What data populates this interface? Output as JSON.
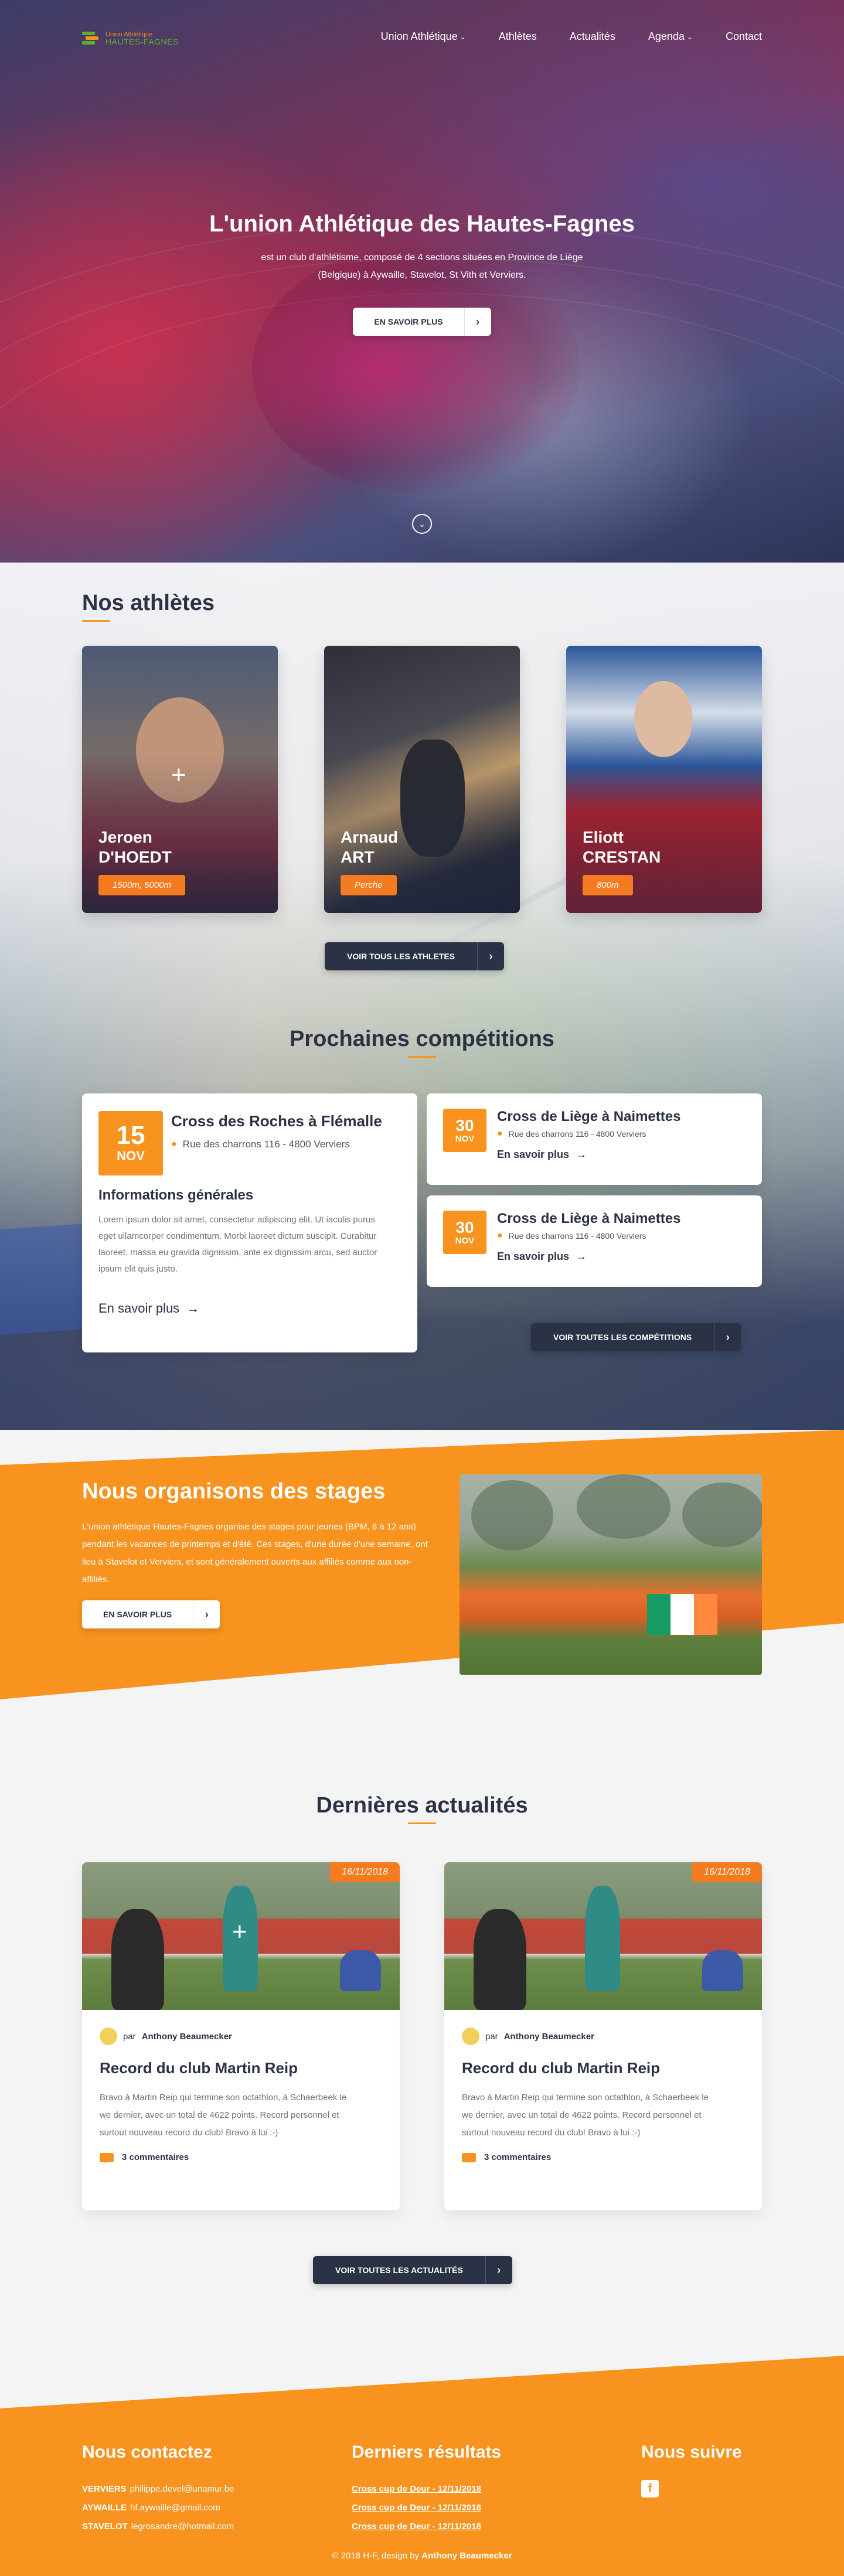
{
  "nav": {
    "logo_line1": "Union Athlétique",
    "logo_line2": "HAUTES-FAGNES",
    "items": [
      "Union Athlétique",
      "Athlètes",
      "Actualités",
      "Agenda",
      "Contact"
    ]
  },
  "hero": {
    "title": "L'union Athlétique des Hautes-Fagnes",
    "subtitle": "est un club d'athlétisme, composé de 4 sections situées en Province de Liège (Belgique) à Aywaille, Stavelot, St Vith et Verviers.",
    "button": "EN SAVOIR PLUS"
  },
  "athletes": {
    "title": "Nos athlètes",
    "cards": [
      {
        "first": "Jeroen",
        "last": "D'HOEDT",
        "discipline": "1500m, 5000m"
      },
      {
        "first": "Arnaud",
        "last": "ART",
        "discipline": "Perche"
      },
      {
        "first": "Eliott",
        "last": "CRESTAN",
        "discipline": "800m"
      }
    ],
    "button": "VOIR TOUS LES ATHLETES"
  },
  "competitions": {
    "title": "Prochaines compétitions",
    "main": {
      "day": "15",
      "month": "NOV",
      "name": "Cross des Roches à Flémalle",
      "location": "Rue des charrons 116 - 4800 Verviers",
      "info_title": "Informations générales",
      "info_text": "Lorem ipsum dolor sit amet, consectetur adipiscing elit. Ut iaculis purus eget ullamcorper condimentum. Morbi laoreet dictum suscipit. Curabitur laoreet, massa eu gravida dignissim, ante ex dignissim arcu, sed auctor ipsum elit quis justo.",
      "more": "En savoir plus"
    },
    "others": [
      {
        "day": "30",
        "month": "NOV",
        "name": "Cross de Liège à Naimettes",
        "location": "Rue des charrons 116 - 4800 Verviers",
        "more": "En savoir plus"
      },
      {
        "day": "30",
        "month": "NOV",
        "name": "Cross de Liège à Naimettes",
        "location": "Rue des charrons 116 - 4800 Verviers",
        "more": "En savoir plus"
      }
    ],
    "button": "VOIR TOUTES LES COMPÉTITIONS"
  },
  "stages": {
    "title": "Nous organisons des stages",
    "text": "L'union athlétique Hautes-Fagnes organise des stages pour jeunes (BPM, 8 à 12 ans) pendant les vacances de printemps et d'été. Ces stages, d'une durée d'une semaine, ont lieu à Stavelot et Verviers, et sont généralement ouverts aux affiliés comme aux non-affiliés.",
    "button": "EN SAVOIR PLUS"
  },
  "news": {
    "title": "Dernières actualités",
    "cards": [
      {
        "date": "16/11/2018",
        "by": "par",
        "author": "Anthony Beaumecker",
        "title": "Record du club Martin Reip",
        "text": "Bravo à Martin Reip qui termine son octathlon, à Schaerbeek le we dernier, avec un total de 4622 points. Record personnel et surtout nouveau record du club! Bravo à lui :-)",
        "comments": "3 commentaires"
      },
      {
        "date": "16/11/2018",
        "by": "par",
        "author": "Anthony Beaumecker",
        "title": "Record du club Martin Reip",
        "text": "Bravo à Martin Reip qui termine son octathlon, à Schaerbeek le we dernier, avec un total de 4622 points. Record personnel et surtout nouveau record du club! Bravo à lui :-)",
        "comments": "3 commentaires"
      }
    ],
    "button": "VOIR TOUTES LES ACTUALITÉS"
  },
  "footer": {
    "contact_title": "Nous contactez",
    "contacts": [
      {
        "section": "VERVIERS",
        "email": "philippe.devel@unamur.be"
      },
      {
        "section": "AYWAILLE",
        "email": "hf.aywaille@gmail.com"
      },
      {
        "section": "STAVELOT",
        "email": "legrosandre@hotmail.com"
      }
    ],
    "results_title": "Derniers résultats",
    "results": [
      "Cross cup de Deur - 12/11/2018",
      "Cross cup de Deur - 12/11/2018",
      "Cross cup de Deur - 12/11/2018"
    ],
    "follow_title": "Nous suivre",
    "copyright_prefix": "© 2018 H-F, design by",
    "copyright_author": "Anthony Beaumecker"
  },
  "colors": {
    "accent": "#f7931e",
    "dark": "#2b3245",
    "badge": "#f47b20"
  }
}
